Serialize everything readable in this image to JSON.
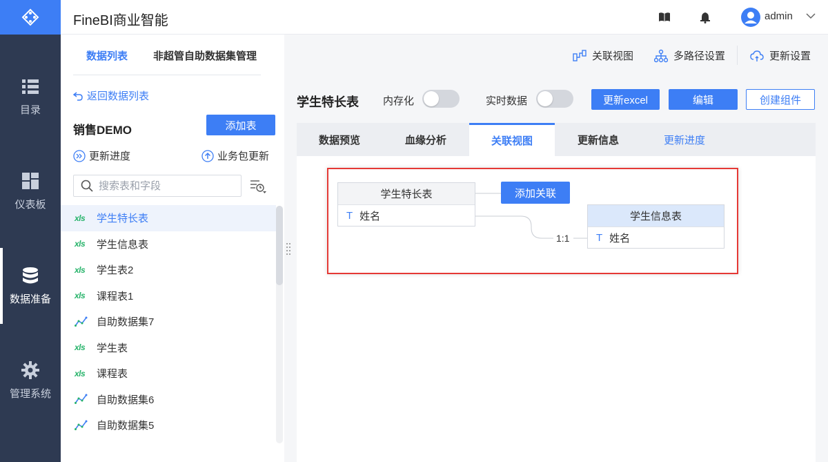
{
  "app": {
    "title": "FineBI商业智能"
  },
  "user": {
    "name": "admin"
  },
  "nav": {
    "items": [
      {
        "label": "目录"
      },
      {
        "label": "仪表板"
      },
      {
        "label": "数据准备"
      },
      {
        "label": "管理系统"
      }
    ]
  },
  "panel": {
    "tabs": [
      {
        "label": "数据列表"
      },
      {
        "label": "非超管自助数据集管理"
      }
    ],
    "back": "返回数据列表",
    "package_name": "销售DEMO",
    "add_table": "添加表",
    "update_progress": "更新进度",
    "package_update": "业务包更新",
    "search_placeholder": "搜索表和字段",
    "items": [
      {
        "label": "学生特长表",
        "type": "xls"
      },
      {
        "label": "学生信息表",
        "type": "xls"
      },
      {
        "label": "学生表2",
        "type": "xls"
      },
      {
        "label": "课程表1",
        "type": "xls"
      },
      {
        "label": "自助数据集7",
        "type": "dataset"
      },
      {
        "label": "学生表",
        "type": "xls"
      },
      {
        "label": "课程表",
        "type": "xls"
      },
      {
        "label": "自助数据集6",
        "type": "dataset"
      },
      {
        "label": "自助数据集5",
        "type": "dataset"
      }
    ],
    "xls_glyph": "xls"
  },
  "toolbar": {
    "relation_view": "关联视图",
    "multipath": "多路径设置",
    "update_settings": "更新设置"
  },
  "main": {
    "title": "学生特长表",
    "in_memory": "内存化",
    "realtime": "实时数据",
    "update_excel": "更新excel",
    "edit": "编辑",
    "create_component": "创建组件",
    "tabs": [
      {
        "label": "数据预览"
      },
      {
        "label": "血缘分析"
      },
      {
        "label": "关联视图"
      },
      {
        "label": "更新信息"
      },
      {
        "label": "更新进度"
      }
    ]
  },
  "diagram": {
    "left_table": {
      "name": "学生特长表",
      "field": "姓名",
      "field_type": "T"
    },
    "right_table": {
      "name": "学生信息表",
      "field": "姓名",
      "field_type": "T"
    },
    "add_relation": "添加关联",
    "ratio": "1:1"
  },
  "colors": {
    "primary": "#3d7ef5",
    "nav_bg": "#2e3a52",
    "highlight": "#e53935",
    "xls_green": "#27b36a"
  }
}
